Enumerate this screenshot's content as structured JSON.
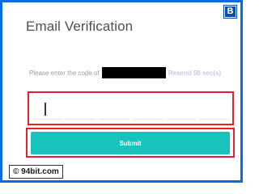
{
  "dialog": {
    "title": "Email Verification",
    "prompt": "Please enter the code of",
    "resend_label": "Resend 58 sec(s)"
  },
  "code_input": {
    "cell_count": 6,
    "active_index": 0
  },
  "actions": {
    "submit_label": "Submit"
  },
  "branding": {
    "badge_letter": "B",
    "watermark": "© 94bit.com"
  },
  "colors": {
    "frame_border": "#0d6dd8",
    "submit_background": "#18c2bd",
    "highlight_border": "#e8202a",
    "resend_text": "#c1cbe6",
    "prompt_text": "#9a9ca3"
  }
}
